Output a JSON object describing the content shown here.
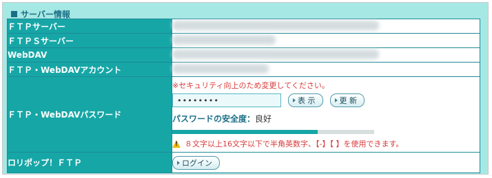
{
  "section": {
    "title": "サーバー情報"
  },
  "rows": [
    {
      "label": "ＦＴＰサーバー"
    },
    {
      "label": "ＦＴＰＳサーバー"
    },
    {
      "label": "WebDAV"
    },
    {
      "label": "ＦＴＰ・WebDAVアカウント"
    }
  ],
  "password": {
    "label": "ＦＴＰ・WebDAVパスワード",
    "notice": "※セキュリティ向上のため変更してください。",
    "value": "••••••••",
    "show_button": "表 示",
    "update_button": "更 新",
    "strength_label": "パスワードの安全度：",
    "strength_value": "良好",
    "strength_fraction": 0.72,
    "warning": "８文字以上16文字以下で半角英数字、【-】【 】を使用できます。",
    "warning_color": "#d93a3a"
  },
  "lolipop": {
    "label": "ロリポップ！ＦＴＰ",
    "login_button": "ログイン"
  },
  "colors": {
    "accent": "#16a6a6",
    "panel": "#a6e8e4",
    "title": "#1a6f86"
  }
}
